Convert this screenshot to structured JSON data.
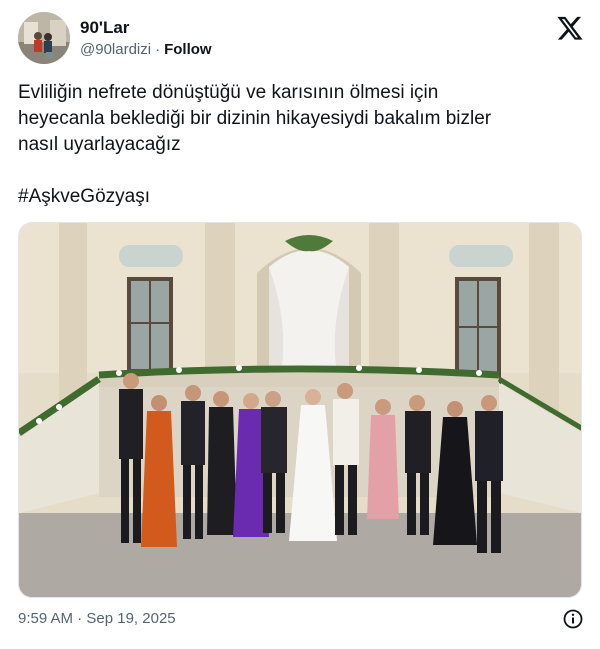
{
  "author": {
    "name": "90'Lar",
    "handle": "@90lardizi",
    "separator": "·",
    "follow_label": "Follow"
  },
  "tweet": {
    "lines": [
      "Evliliğin nefrete dönüştüğü ve karısının ölmesi için",
      "heyecanla beklediği bir dizinin hikayesiydi bakalım bizler",
      "nasıl uyarlayacağız"
    ],
    "hashtag": "#AşkveGözyaşı"
  },
  "footer": {
    "time": "9:59 AM",
    "separator": "·",
    "date": "Sep 19, 2025"
  },
  "icons": {
    "x_logo": "x-logo-icon",
    "info": "info-icon"
  },
  "colors": {
    "text": "#0f1419",
    "muted": "#536471"
  }
}
